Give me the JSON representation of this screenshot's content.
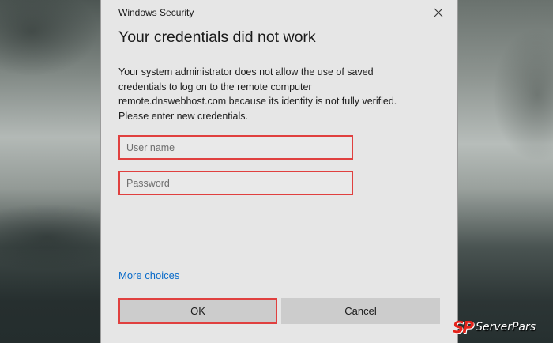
{
  "window": {
    "title": "Windows Security",
    "close_icon": "close-icon"
  },
  "dialog": {
    "heading": "Your credentials did not work",
    "message_lines": [
      "Your system administrator does not allow the use of saved",
      "credentials to log on to the remote computer",
      "remote.dnswebhost.com because its identity is not fully verified.",
      "Please enter new credentials."
    ]
  },
  "form": {
    "username_placeholder": "User name",
    "username_value": "",
    "password_placeholder": "Password",
    "password_value": "",
    "more_choices": "More choices",
    "ok_label": "OK",
    "cancel_label": "Cancel"
  },
  "colors": {
    "dialog_bg": "#e6e6e6",
    "highlight_border": "#e0403f",
    "link": "#0a6bc9",
    "button_bg": "#cccccc"
  },
  "watermark": {
    "mark": "SP",
    "text": "ServerPars"
  }
}
